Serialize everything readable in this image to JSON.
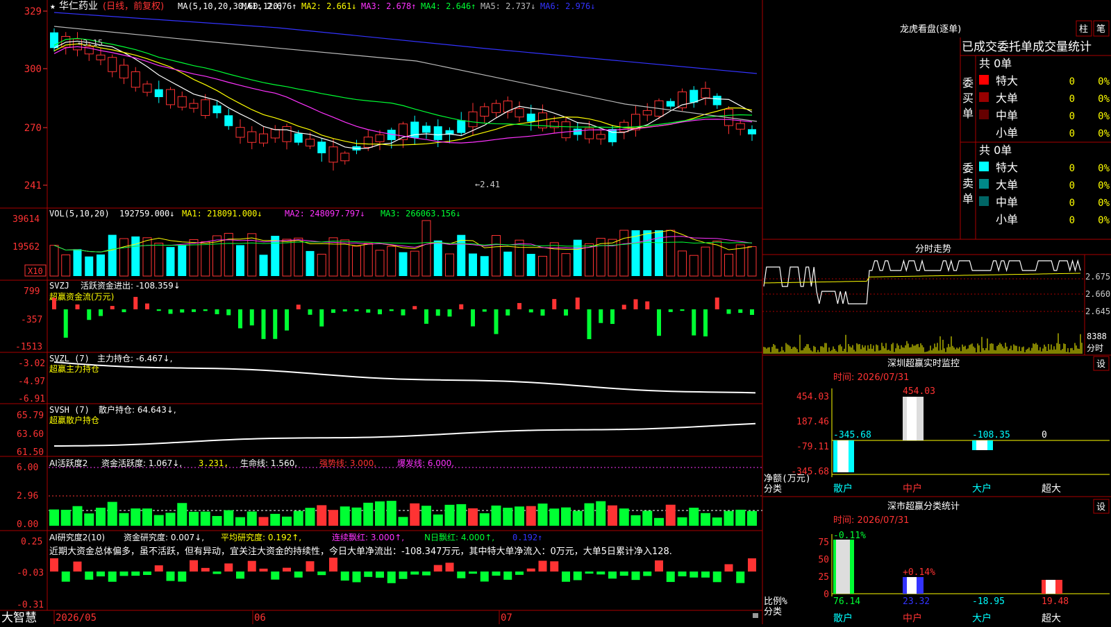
{
  "colors": {
    "up": "#ff3333",
    "down": "#00ffff",
    "panel_border": "#aa0000",
    "yellow": "#ffff00",
    "magenta": "#ff33ff",
    "green": "#00ff33",
    "white": "#ffffff",
    "blue": "#3333ff",
    "gray": "#bbbbbb",
    "teal": "#007777",
    "dark_red": "#7a0000"
  },
  "header": {
    "star": "★",
    "stock": "华仁药业",
    "period": "(日线，前复权)",
    "ma_def": "MA(5,10,20,30,60,120)",
    "ma": [
      {
        "label": "MA1: 2.676↑",
        "color": "#ffffff"
      },
      {
        "label": "MA2: 2.661↓",
        "color": "#ffff00"
      },
      {
        "label": "MA3: 2.678↑",
        "color": "#ff33ff"
      },
      {
        "label": "MA4: 2.646↑",
        "color": "#00ff33"
      },
      {
        "label": "MA5: 2.737↓",
        "color": "#bbbbbb"
      },
      {
        "label": "MA6: 2.976↓",
        "color": "#3333ff"
      }
    ]
  },
  "main_axis": {
    "labels": [
      "329",
      "300",
      "270",
      "241"
    ]
  },
  "price_annotations": {
    "high": "←3.15",
    "low": "←2.41"
  },
  "vol_panel": {
    "title": "VOL(5,10,20)",
    "value": "192759.000↓",
    "ma1": "MA1: 218091.000↓",
    "ma2": "MA2: 248097.797↓",
    "ma3": "MA3: 266063.156↓",
    "axis": [
      "39614",
      "19562"
    ],
    "unit": "X10"
  },
  "svzj_panel": {
    "title": "SVZJ",
    "line": "活跃资金进出: -108.359↓",
    "subtitle": "超赢资金流(万元)",
    "axis": [
      "799",
      "-357",
      "-1513"
    ]
  },
  "svzl_panel": {
    "title": "SVZL (7)",
    "line": "主力持仓: -6.467↓,",
    "subtitle": "超赢主力持仓",
    "axis": [
      "-3.02",
      "-4.97",
      "-6.91"
    ]
  },
  "svsh_panel": {
    "title": "SVSH (7)",
    "line": "散户持仓: 64.643↓,",
    "subtitle": "超赢散户持仓",
    "axis": [
      "65.79",
      "63.60",
      "61.50"
    ]
  },
  "ai_active_panel": {
    "title": "AI活跃度2",
    "a": "资金活跃度: 1.067↓,",
    "b": "3.231,",
    "c": "生命线: 1.560,",
    "d": "强势线: 3.000,",
    "e": "爆发线: 6.000,",
    "axis": [
      "6.00",
      "2.96",
      "0.00"
    ]
  },
  "ai_research_panel": {
    "title": "AI研究度2(10)",
    "a": "资金研究度: 0.007↓,",
    "b": "平均研究度: 0.192↑,",
    "c": "连续飘红: 3.000↑,",
    "d": "N日飘红: 4.000↑,",
    "e": "0.192↑",
    "comment": "近期大资金总体偏多，虽不活跃，但有异动，宜关注大资金的持续性，今日大单净流出：-108.347万元，其中特大单净流入：0万元，大单5日累计净入128.",
    "axis": [
      "0.25",
      "-0.03",
      "-0.31"
    ]
  },
  "bottom_bar": {
    "brand": "大智慧",
    "dates": [
      "2026/05",
      "06",
      "07"
    ]
  },
  "longhu": {
    "title": "龙虎看盘(逐单)",
    "btn1": "柱",
    "btn2": "笔",
    "section_title": "已成交委托单成交量统计",
    "buy_label": "委买单",
    "sell_label": "委卖单",
    "buy_total": "共 0单",
    "sell_total": "共 0单",
    "buy_rows": [
      {
        "name": "特大",
        "count": "0",
        "pct": "0%",
        "color": "#ff0000"
      },
      {
        "name": "大单",
        "count": "0",
        "pct": "0%",
        "color": "#990000"
      },
      {
        "name": "中单",
        "count": "0",
        "pct": "0%",
        "color": "#660000"
      },
      {
        "name": "小单",
        "count": "0",
        "pct": "0%",
        "color": ""
      }
    ],
    "sell_rows": [
      {
        "name": "特大",
        "count": "0",
        "pct": "0%",
        "color": "#00ffff"
      },
      {
        "name": "大单",
        "count": "0",
        "pct": "0%",
        "color": "#008888"
      },
      {
        "name": "中单",
        "count": "0",
        "pct": "0%",
        "color": "#006666"
      },
      {
        "name": "小单",
        "count": "0",
        "pct": "0%",
        "color": ""
      }
    ]
  },
  "intraday": {
    "title": "分时走势",
    "axis": [
      "2.675",
      "2.660",
      "2.645"
    ],
    "vol_label": "8388",
    "vol_unit": "分时"
  },
  "sz_monitor": {
    "title": "深圳超赢实时监控",
    "btn": "设",
    "time": "时间: 2026/07/31",
    "axis": [
      "454.03",
      "187.46",
      "-79.11",
      "-345.68"
    ],
    "ylabel": "净额(万元)",
    "xlabel": "分类",
    "values": [
      "-345.68",
      "454.03",
      "-108.35",
      "0"
    ],
    "categories": [
      "散户",
      "中户",
      "大户",
      "超大"
    ]
  },
  "sz_class": {
    "title": "深市超赢分类统计",
    "btn": "设",
    "time": "时间: 2026/07/31",
    "axis": [
      "75",
      "50",
      "25",
      "0"
    ],
    "ylabel": "比例%",
    "xlabel": "分类",
    "top_values": [
      "-0.11%",
      "+0.14%"
    ],
    "values": [
      "76.14",
      "23.32",
      "-18.95",
      "19.48"
    ],
    "categories": [
      "散户",
      "中户",
      "大户",
      "超大"
    ]
  }
}
